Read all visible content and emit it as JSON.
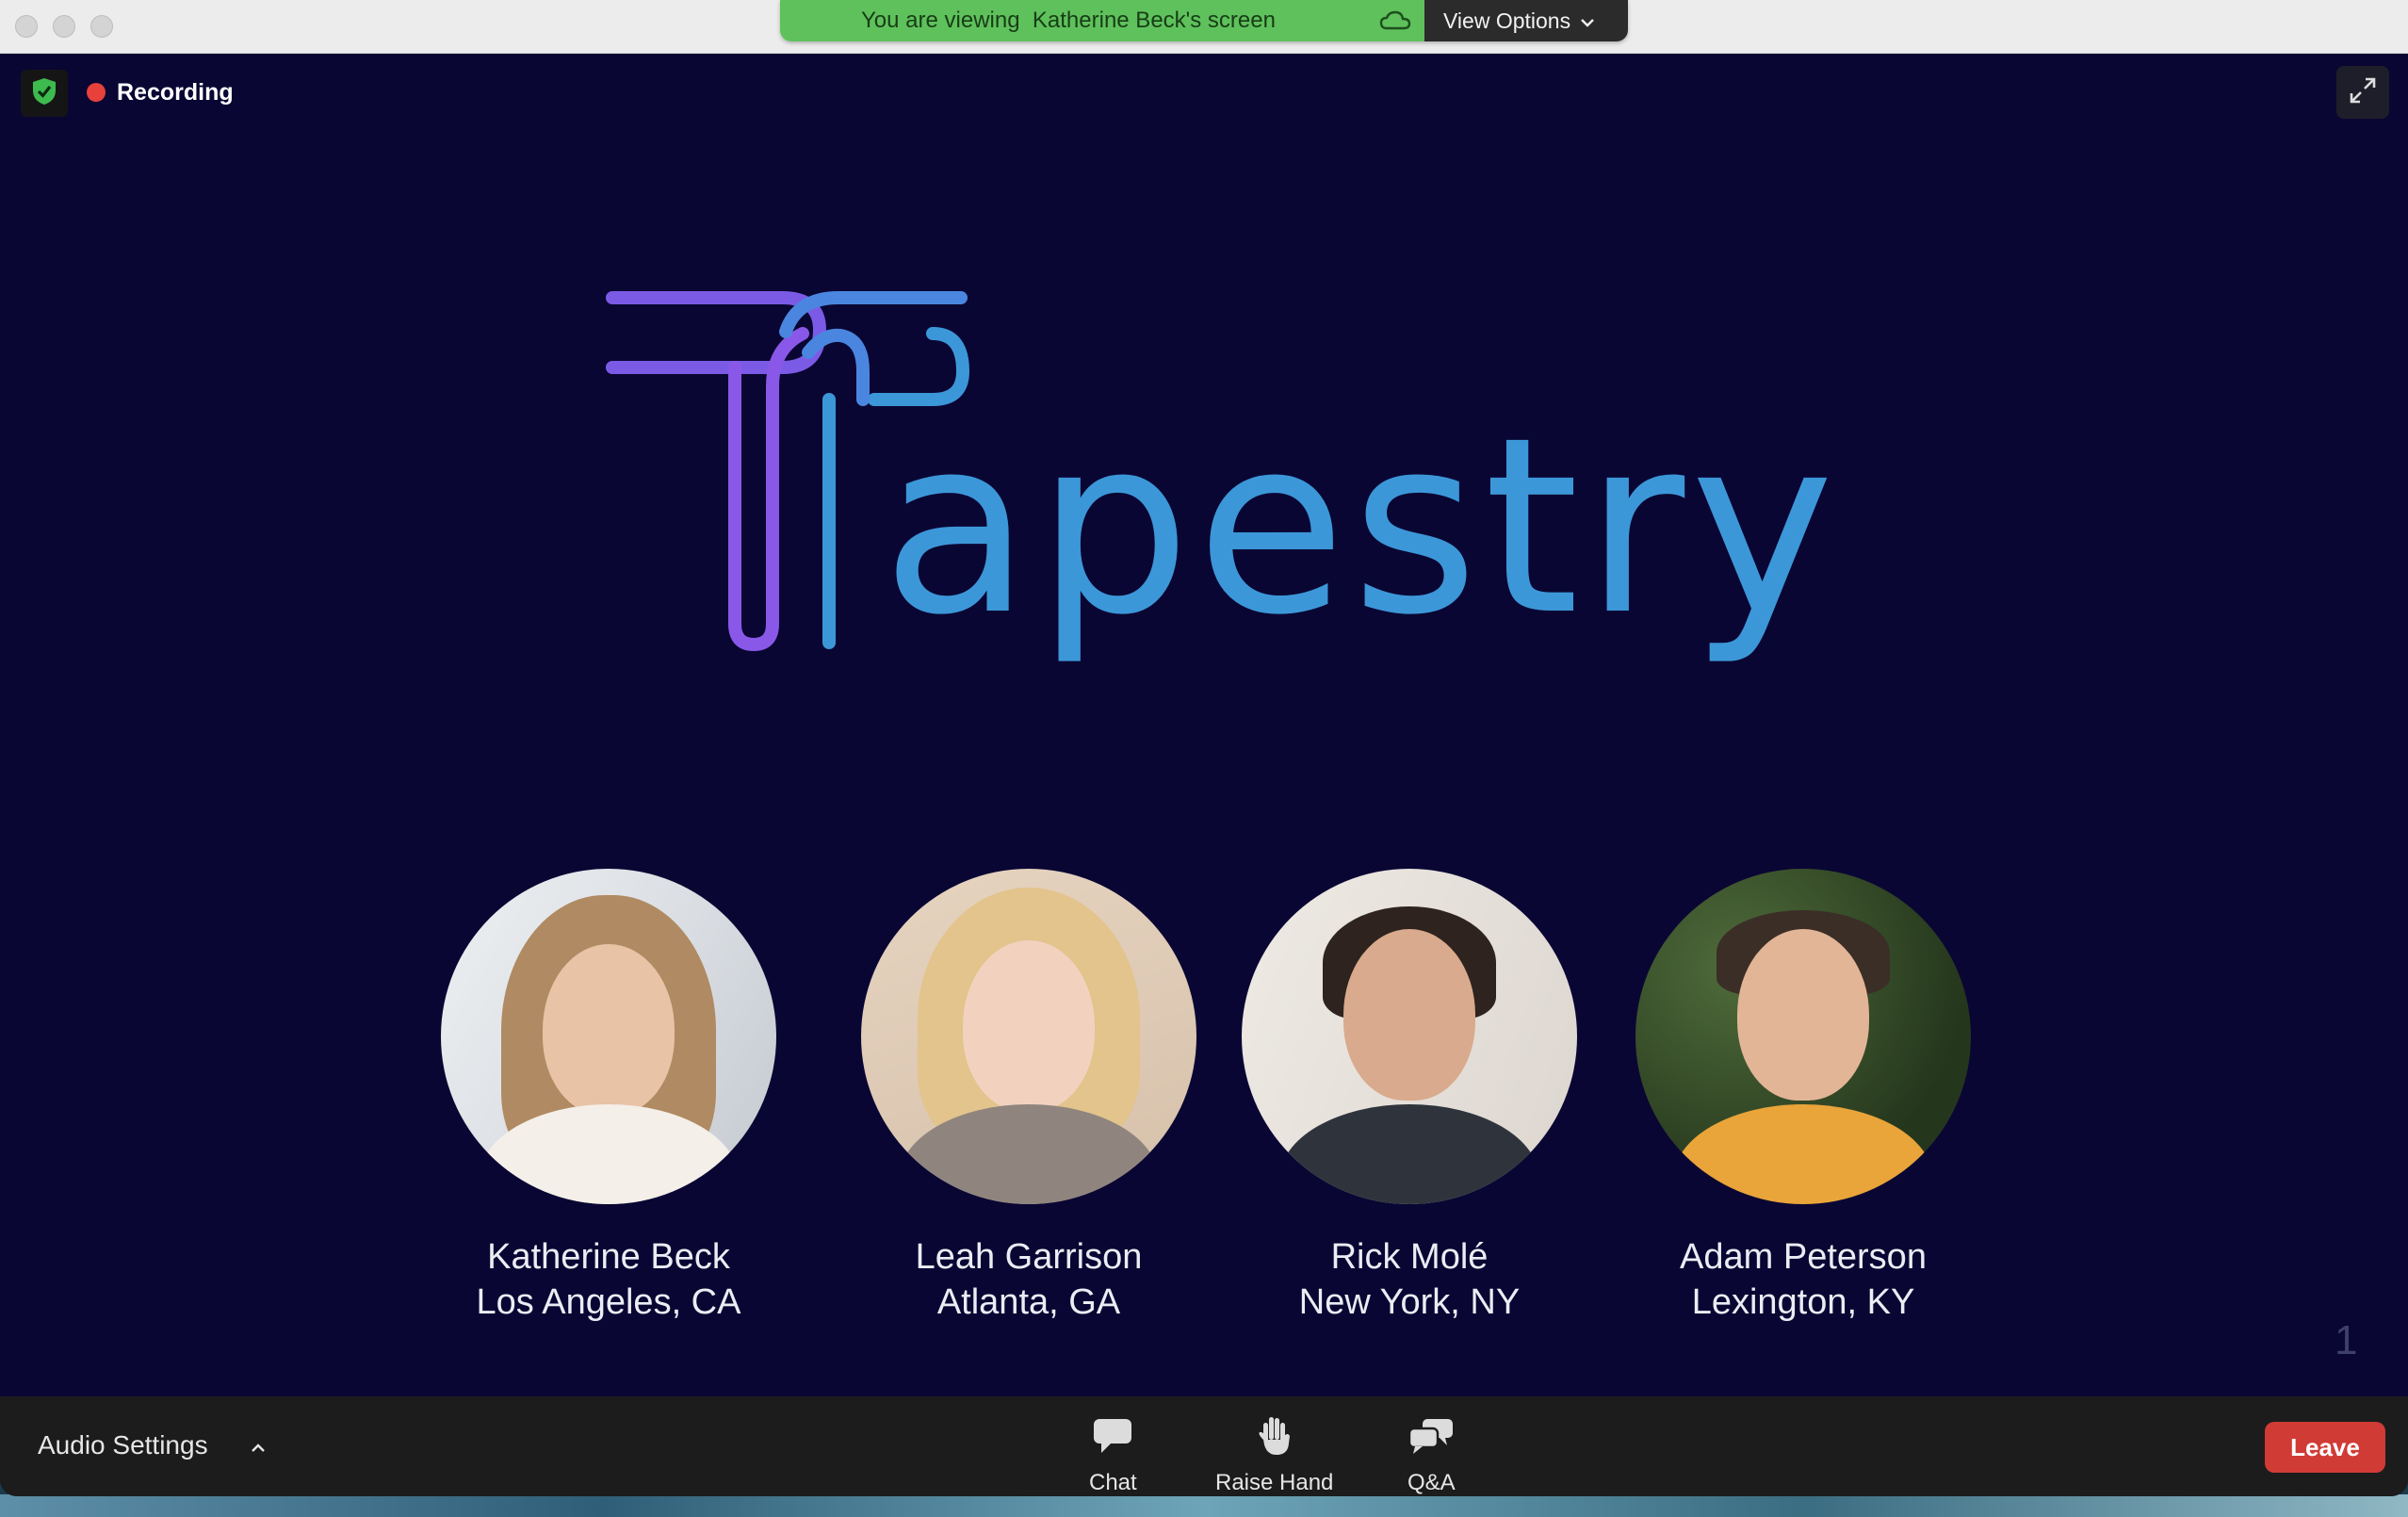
{
  "banner": {
    "viewing_text": "You are viewing  Katherine Beck's screen",
    "view_options_label": "View Options"
  },
  "status": {
    "recording_label": "Recording"
  },
  "slide": {
    "logo_text": "apestry",
    "logo_colors": {
      "purple": "#7b5be6",
      "blue": "#3c97d8",
      "background": "#0a0633"
    },
    "team": [
      {
        "name": "Katherine Beck",
        "location": "Los Angeles, CA"
      },
      {
        "name": "Leah Garrison",
        "location": "Atlanta, GA"
      },
      {
        "name": "Rick Molé",
        "location": "New York, NY"
      },
      {
        "name": "Adam Peterson",
        "location": "Lexington, KY"
      }
    ],
    "page_number": "1"
  },
  "toolbar": {
    "audio_settings_label": "Audio Settings",
    "chat_label": "Chat",
    "raise_hand_label": "Raise Hand",
    "qa_label": "Q&A",
    "leave_label": "Leave"
  },
  "icons": [
    "shield-check-icon",
    "recording-dot-icon",
    "expand-icon",
    "cloud-icon",
    "chevron-down-icon",
    "chevron-up-icon",
    "chat-icon",
    "raise-hand-icon",
    "qa-icon"
  ],
  "colors": {
    "banner_green": "#5fc15c",
    "leave_red": "#d13b35",
    "recording_red": "#e8403a"
  }
}
